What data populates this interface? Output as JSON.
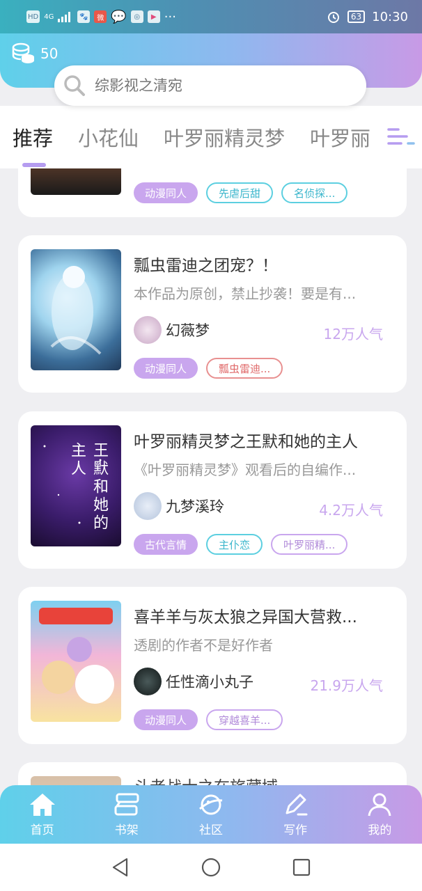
{
  "status_bar": {
    "time": "10:30",
    "battery": "63",
    "network": "4G",
    "icons": [
      "hd-icon",
      "signal-icon",
      "baidu-icon",
      "weibo-icon",
      "wechat-icon",
      "app-icon",
      "video-icon",
      "more-icon",
      "alarm-icon",
      "battery-icon"
    ]
  },
  "header": {
    "coins": "50",
    "search_placeholder": "综影视之清宛"
  },
  "tabs": [
    {
      "label": "推荐",
      "active": true
    },
    {
      "label": "小花仙"
    },
    {
      "label": "叶罗丽精灵梦"
    },
    {
      "label": "叶罗丽"
    }
  ],
  "cards": [
    {
      "tags": [
        "动漫同人",
        "先虐后甜",
        "名侦探..."
      ]
    },
    {
      "title": "瓢虫雷迪之团宠？！",
      "desc": "本作品为原创，禁止抄袭！要是有...",
      "author": "幻薇梦",
      "popularity": "12万人气",
      "tags": [
        "动漫同人",
        "瓢虫雷迪..."
      ]
    },
    {
      "title": "叶罗丽精灵梦之王默和她的主人",
      "desc": "《叶罗丽精灵梦》观看后的自编作...",
      "author": "九梦溪玲",
      "popularity": "4.2万人气",
      "tags": [
        "古代言情",
        "主仆恋",
        "叶罗丽精..."
      ],
      "cover_text": "王默和她的主人"
    },
    {
      "title": "喜羊羊与灰太狼之异国大营救...",
      "desc": "透剧的作者不是好作者",
      "author": "任性滴小丸子",
      "popularity": "21.9万人气",
      "tags": [
        "动漫同人",
        "穿越喜羊..."
      ]
    },
    {
      "title": "斗老战士之在旅藏域"
    }
  ],
  "bottom_nav": [
    {
      "label": "首页",
      "icon": "home-icon"
    },
    {
      "label": "书架",
      "icon": "bookshelf-icon"
    },
    {
      "label": "社区",
      "icon": "planet-icon"
    },
    {
      "label": "写作",
      "icon": "pen-icon"
    },
    {
      "label": "我的",
      "icon": "user-icon"
    }
  ],
  "colors": {
    "accent_purple": "#c9a6ee",
    "accent_teal": "#5ccfe0",
    "gradient_start": "#5fd0ea",
    "gradient_end": "#c89ae6"
  }
}
